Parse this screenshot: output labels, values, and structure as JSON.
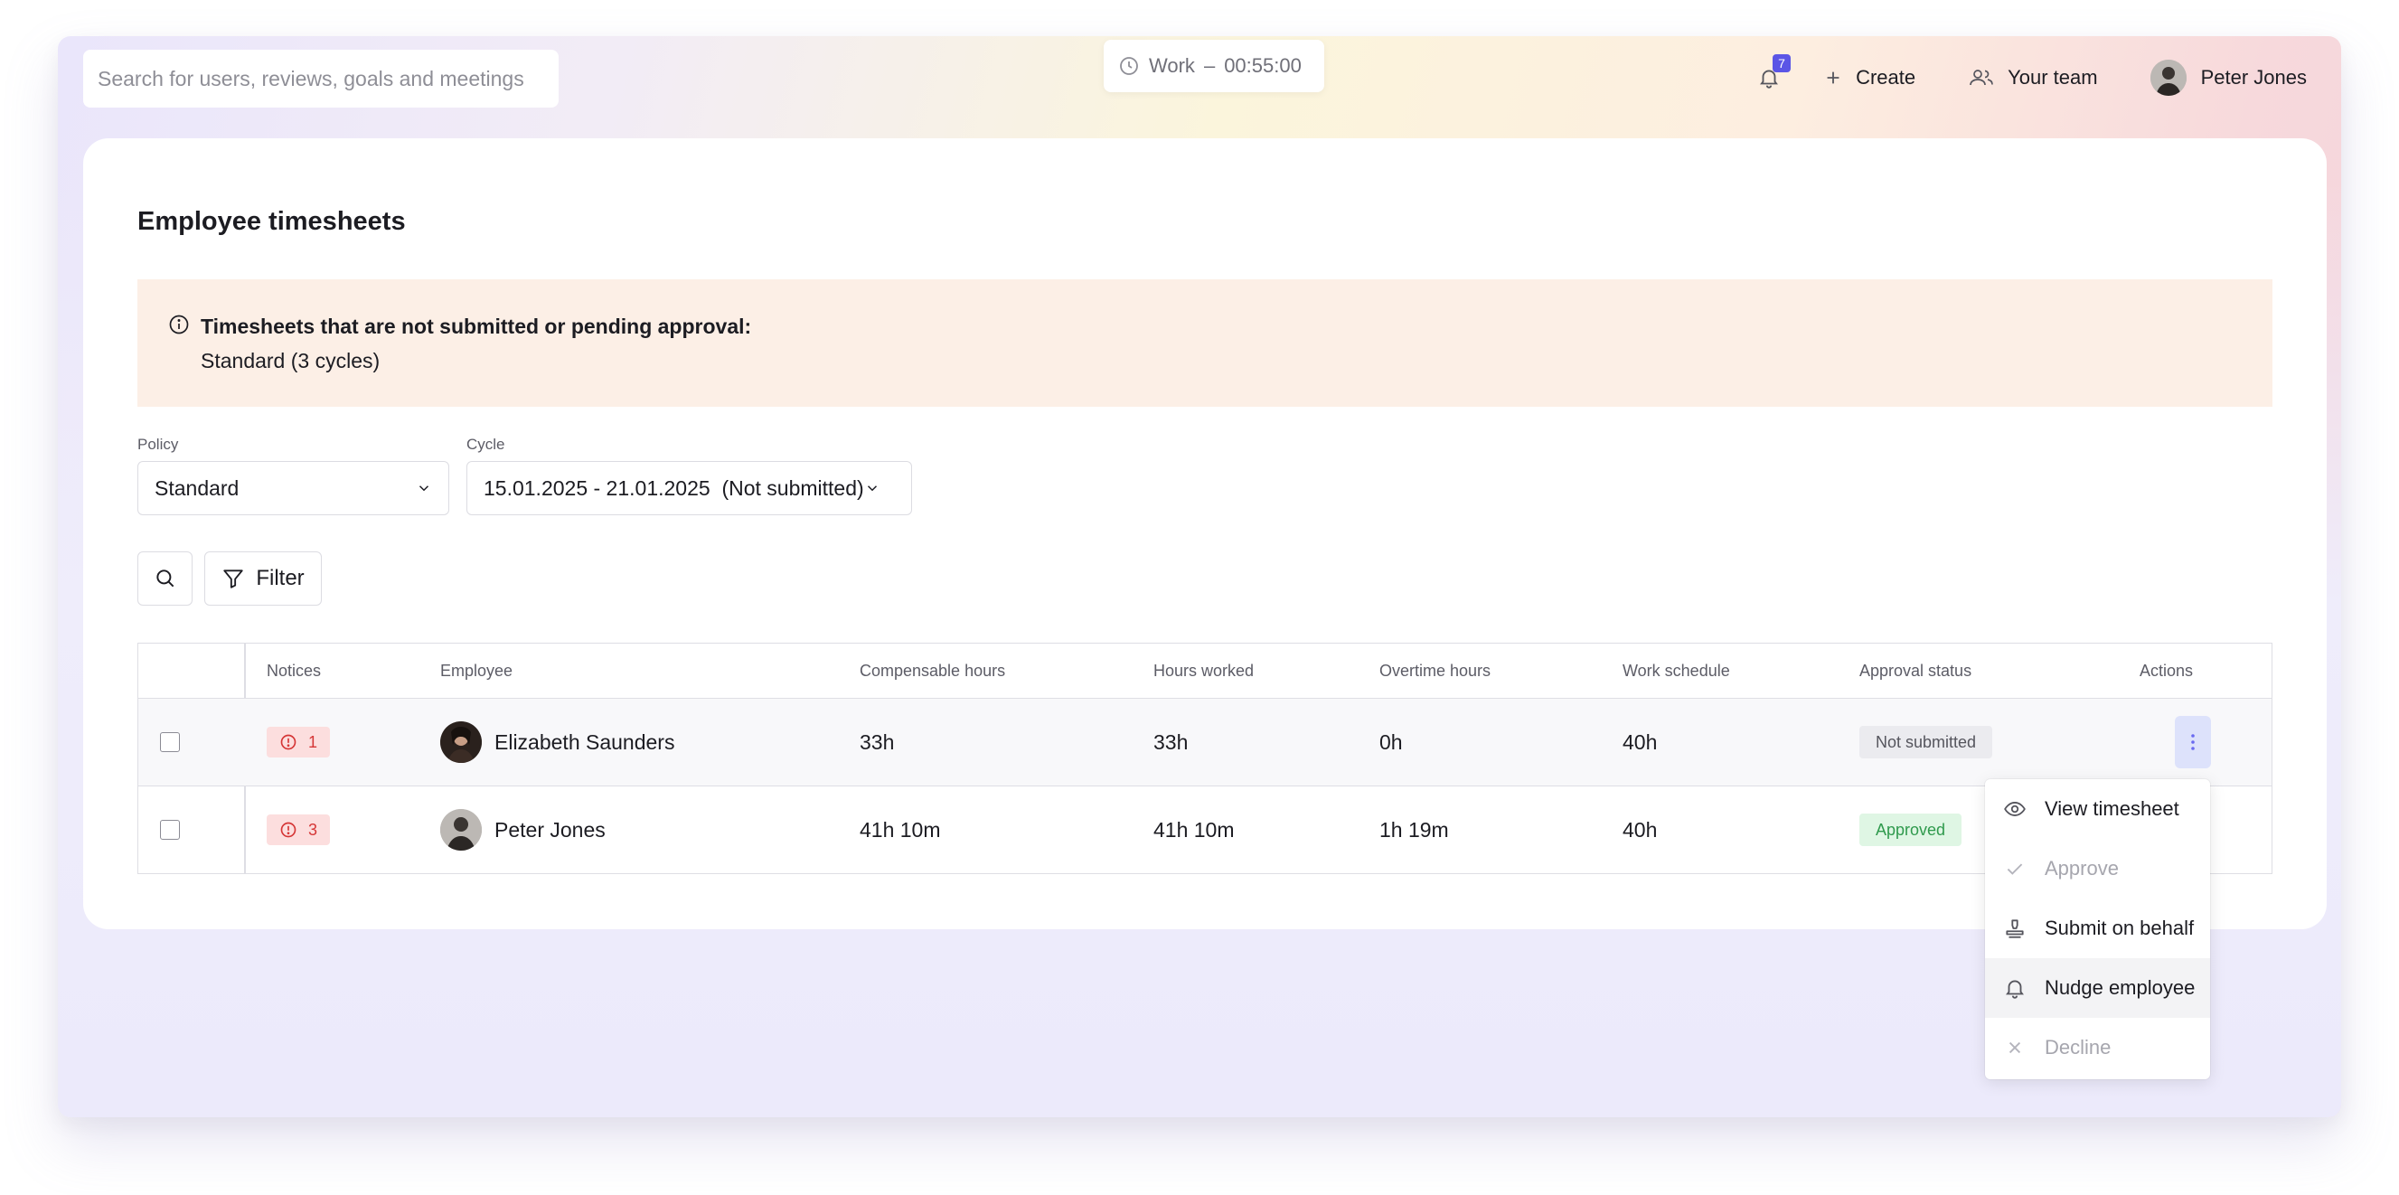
{
  "topbar": {
    "search_placeholder": "Search for users, reviews, goals and meetings",
    "timer": {
      "label": "Work",
      "separator": "–",
      "time": "00:55:00"
    },
    "notifications_count": "7",
    "create_label": "Create",
    "team_label": "Your team",
    "user_name": "Peter Jones"
  },
  "page": {
    "title": "Employee timesheets",
    "notice": {
      "title": "Timesheets that are not submitted or pending approval:",
      "detail": "Standard (3 cycles)"
    },
    "policy": {
      "label": "Policy",
      "value": "Standard"
    },
    "cycle": {
      "label": "Cycle",
      "value": "15.01.2025 - 21.01.2025  (Not submitted)"
    },
    "filter_label": "Filter"
  },
  "table": {
    "columns": [
      "Notices",
      "Employee",
      "Compensable hours",
      "Hours worked",
      "Overtime hours",
      "Work schedule",
      "Approval status",
      "Actions"
    ],
    "rows": [
      {
        "notices": "1",
        "employee": "Elizabeth Saunders",
        "compensable": "33h",
        "worked": "33h",
        "overtime": "0h",
        "schedule": "40h",
        "status": "Not submitted"
      },
      {
        "notices": "3",
        "employee": "Peter Jones",
        "compensable": "41h 10m",
        "worked": "41h 10m",
        "overtime": "1h 19m",
        "schedule": "40h",
        "status": "Approved"
      }
    ]
  },
  "actions_menu": {
    "items": [
      {
        "label": "View timesheet",
        "icon": "eye-icon",
        "disabled": false
      },
      {
        "label": "Approve",
        "icon": "check-icon",
        "disabled": true
      },
      {
        "label": "Submit on behalf",
        "icon": "stamp-icon",
        "disabled": false
      },
      {
        "label": "Nudge employee",
        "icon": "bell-icon",
        "disabled": false
      },
      {
        "label": "Decline",
        "icon": "x-icon",
        "disabled": true
      }
    ]
  },
  "colors": {
    "accent": "#5b55e6",
    "notice_bg": "#fcefe6",
    "status_approved": "#2f9a4d",
    "status_not_submitted": "#55555d",
    "notice_badge": "#d53636"
  }
}
